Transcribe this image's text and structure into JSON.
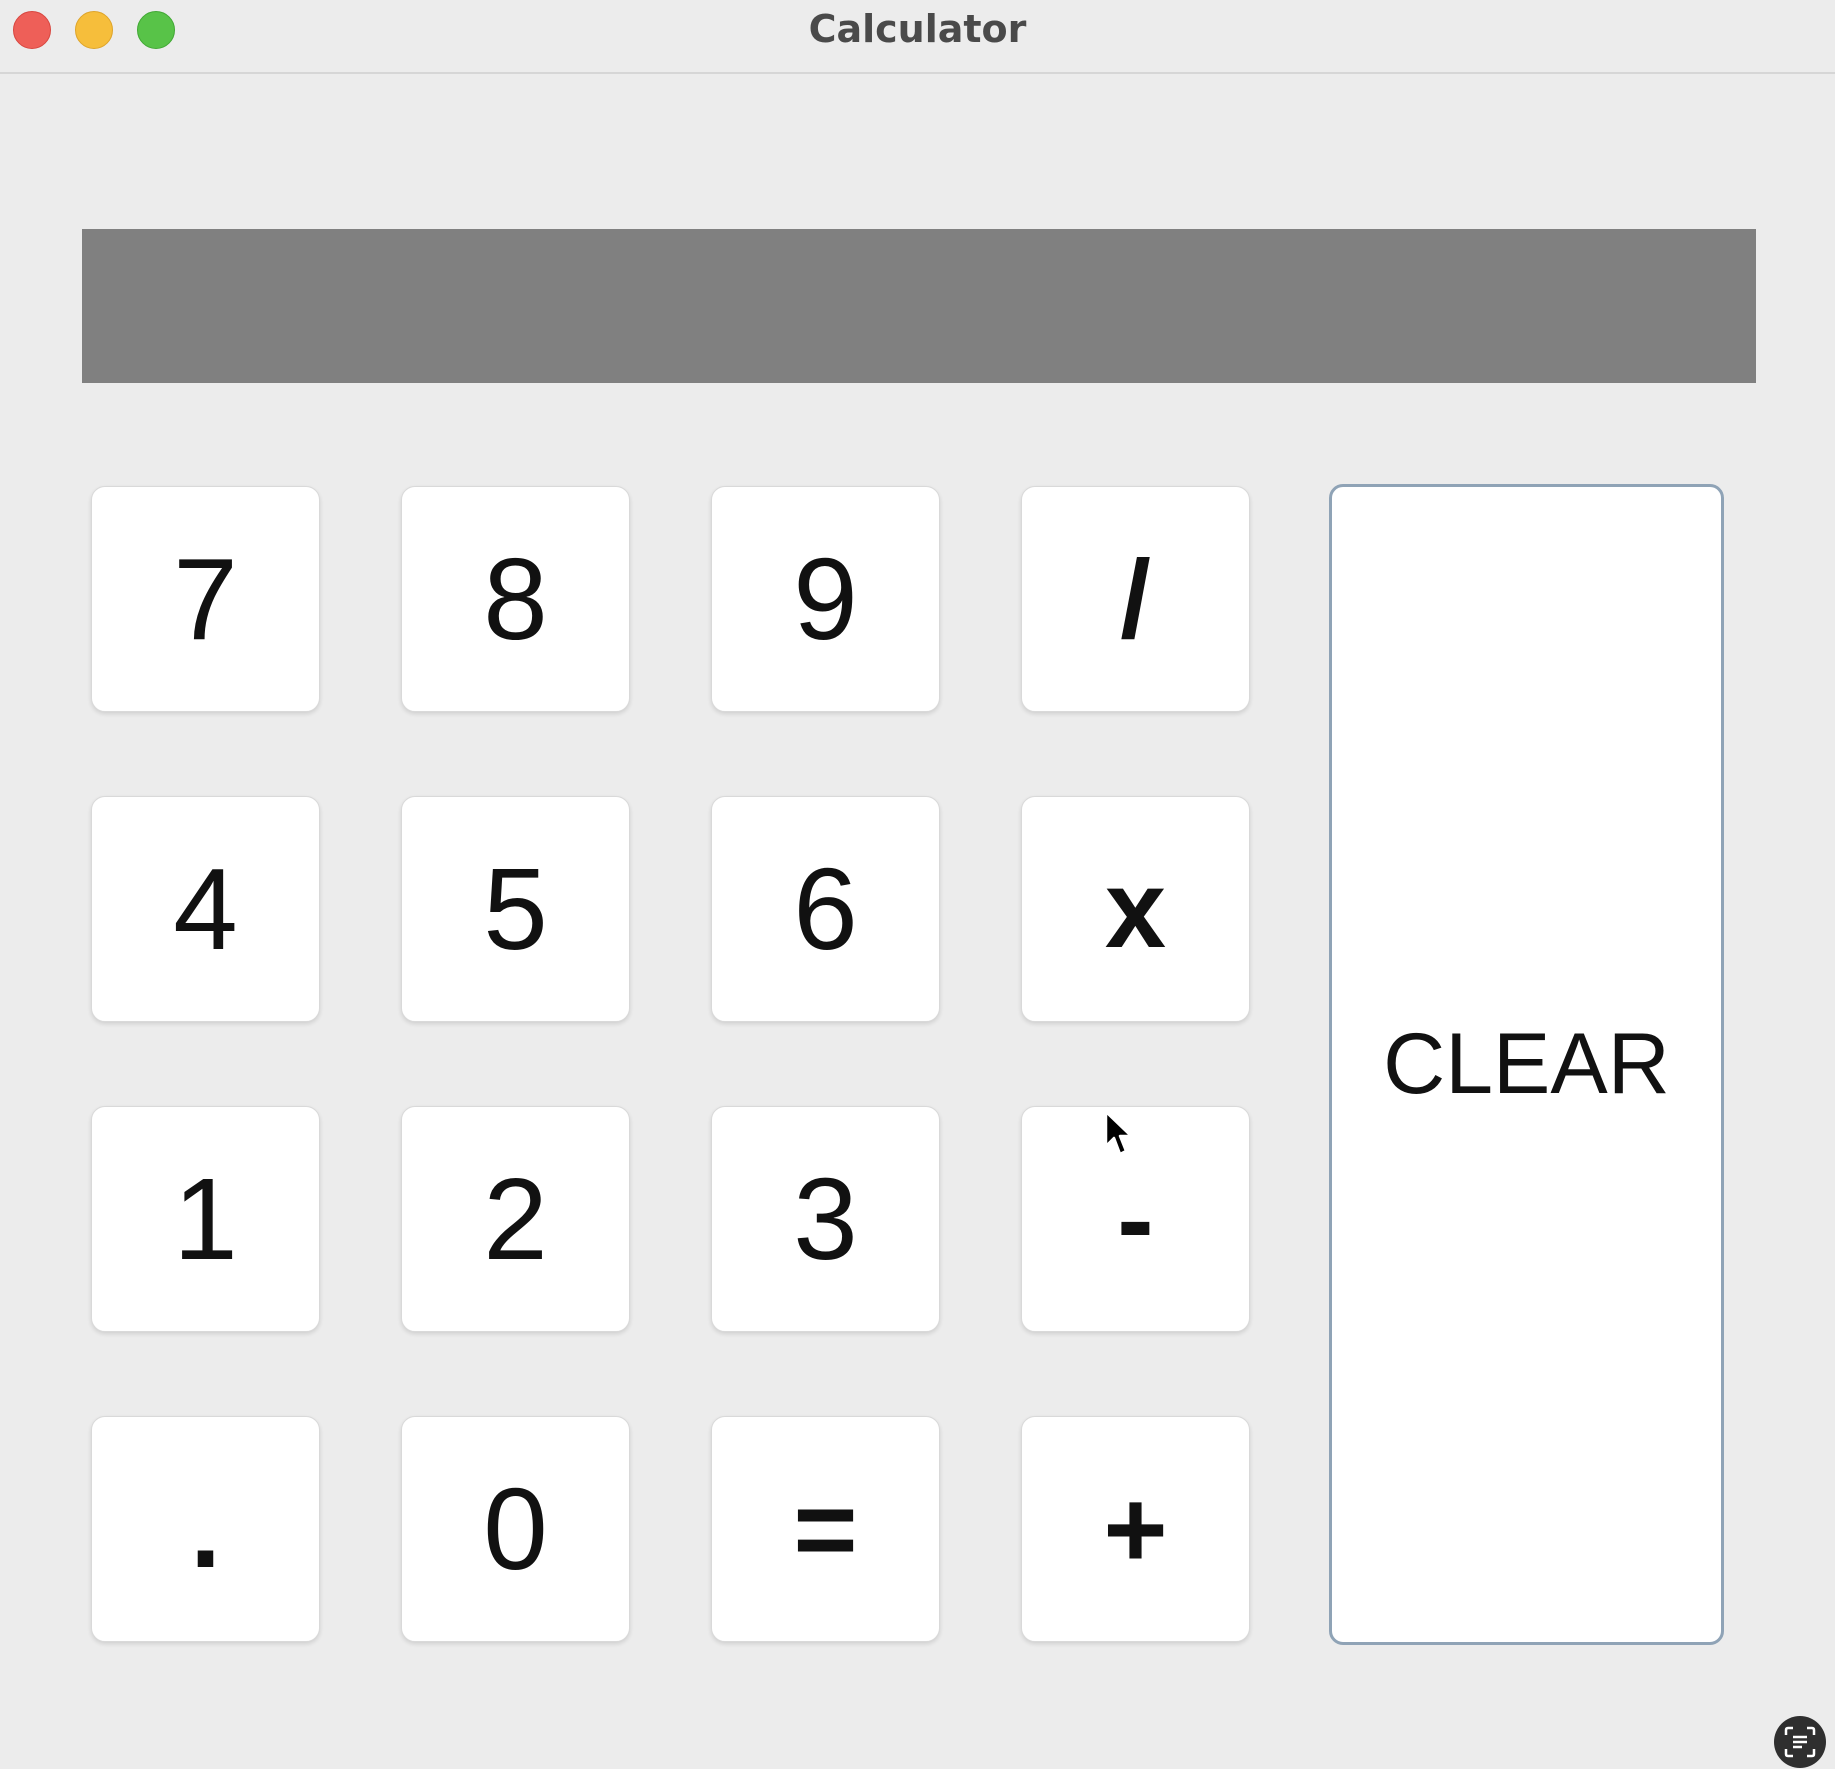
{
  "window": {
    "title": "Calculator"
  },
  "display": {
    "value": ""
  },
  "keys": {
    "k7": "7",
    "k8": "8",
    "k9": "9",
    "divide": "/",
    "k4": "4",
    "k5": "5",
    "k6": "6",
    "multiply": "x",
    "k1": "1",
    "k2": "2",
    "k3": "3",
    "subtract": "-",
    "decimal": ".",
    "k0": "0",
    "equals": "=",
    "add": "+",
    "clear": "CLEAR"
  },
  "colors": {
    "background": "#ececec",
    "display": "#808080",
    "key": "#ffffff",
    "clear_border": "#8fa3b6"
  },
  "icons": {
    "corner": "live-text-icon",
    "pointer": "mouse-pointer-icon"
  }
}
